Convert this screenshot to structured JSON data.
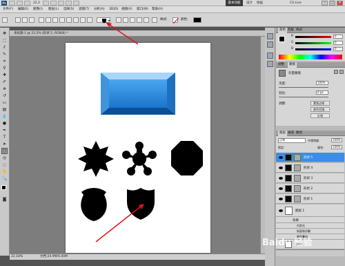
{
  "app": {
    "logo": "Ps",
    "zoom": "22.2",
    "workspace": "基本功能",
    "workspace_items": [
      "设计",
      "绘画",
      "CS Live"
    ],
    "window_buttons": [
      "–",
      "□",
      "✕"
    ]
  },
  "menu": {
    "items": [
      "文件(F)",
      "编辑(E)",
      "图像(I)",
      "图层(L)",
      "选择(S)",
      "滤镜(T)",
      "分析(A)",
      "3D(D)",
      "视图(V)",
      "窗口(W)",
      "帮助(H)"
    ]
  },
  "options": {
    "style_label": "样式:",
    "color_label": "颜色:"
  },
  "document": {
    "tab_label": "未标题-1 @ 22.2% (形状 5, RGB/8) *",
    "zoom_status": "22.18%",
    "doc_status": "文档:24.9M/6.00M"
  },
  "panels": {
    "color_tabs": [
      "颜色",
      "色板",
      "样式"
    ],
    "color_sliders": [
      {
        "label": "R",
        "value": "0"
      },
      {
        "label": "G",
        "value": "0"
      },
      {
        "label": "B",
        "value": "0"
      }
    ],
    "adjust_tabs": [
      "调整",
      "蒙版"
    ],
    "mask_label": "矢量蒙版",
    "density_label": "浓度:",
    "density_value": "100%",
    "feather_label": "羽化:",
    "feather_value": "0 px",
    "refine_label": "调整:",
    "mask_buttons": [
      "蒙版边缘...",
      "颜色范围...",
      "反相"
    ],
    "layers_tabs": [
      "图层",
      "通道",
      "路径"
    ],
    "blend_mode": "正常",
    "opacity_label": "不透明度:",
    "opacity_value": "100%",
    "lock_label": "锁定:",
    "fill_label": "填充:",
    "fill_value": "100%",
    "layers": [
      {
        "name": "形状 5",
        "selected": true
      },
      {
        "name": "形状 4",
        "selected": false
      },
      {
        "name": "形状 3",
        "selected": false
      },
      {
        "name": "形状 2",
        "selected": false
      },
      {
        "name": "形状 1",
        "selected": false
      }
    ],
    "group_layer": "图层 1",
    "effects_label": "效果",
    "effects": [
      "内发光",
      "斜面和浮雕",
      "颜色叠加"
    ],
    "background_layer": "背景"
  },
  "colors": {
    "accent_blue": "#2f86d9",
    "button_gradient_top": "#6fb6f0",
    "button_gradient_bottom": "#0d5fb0",
    "arrow_red": "#e0141b"
  },
  "watermark": "Baidu 经验"
}
